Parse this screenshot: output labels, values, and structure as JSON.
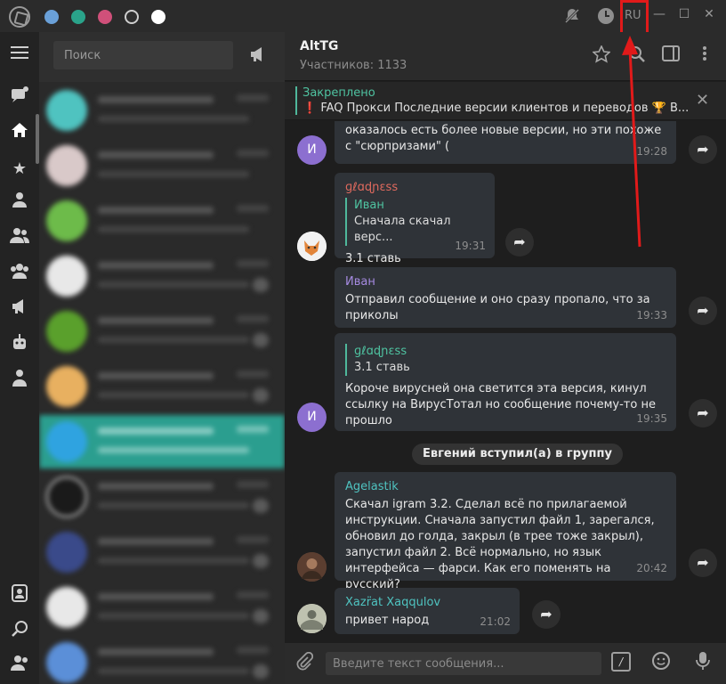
{
  "theme_colors": [
    "#6aa0d8",
    "#2aa38a",
    "#d0507a",
    "#2f2f2f",
    "#ffffff"
  ],
  "titlebar": {
    "lang": "RU"
  },
  "search": {
    "placeholder": "Поиск"
  },
  "chat": {
    "title": "AltTG",
    "subtitle": "Участников: 1133"
  },
  "pinned": {
    "title": "Закреплено",
    "text": "❗ FAQ  Прокси   Последние версии клиентов и переводов 🏆 В..."
  },
  "messages": [
    {
      "text": "оказалось есть более новые версии, но эти похоже с \"сюрпризами\" (",
      "time": "19:28",
      "avatar": "И"
    },
    {
      "sender": "ɡℓɑɖɲɛss",
      "reply_name": "Иван",
      "reply_text": "Сначала скачал верс...",
      "text": "3.1 ставь",
      "time": "19:31"
    },
    {
      "sender": "Иван",
      "text": "Отправил сообщение и оно сразу пропало, что за приколы",
      "time": "19:33"
    },
    {
      "reply_name": "ɡℓɑɖɲɛss",
      "reply_text": "3.1 ставь",
      "text": "Короче вирусней она светится эта версия, кинул ссылку на ВирусТотал но сообщение почему-то не прошло",
      "time": "19:35",
      "avatar": "И"
    },
    {
      "sender": "Agelastik",
      "text": "Скачал igram 3.2. Сделал всё по прилагаемой инструкции. Сначала запустил файл 1, зарегался, обновил до голда, закрыл (в трее тоже закрыл), запустил файл 2. Всё нормально, но язык интерфейса — фарси. Как его поменять на русский?",
      "time": "20:42"
    },
    {
      "sender": "Xazr̈at Xaqqulov",
      "text": "привет народ",
      "time": "21:02"
    }
  ],
  "service_message": "Евгений вступил(а) в группу",
  "compose": {
    "placeholder": "Введите текст сообщения..."
  },
  "chatlist_avatar_colors": [
    "#4fc3c0",
    "#d9c9c9",
    "#6dbb4a",
    "#e8e8e8",
    "#5aa02c",
    "#e8b060",
    "#2fa3e0",
    "#1a1a1a",
    "#3a4a8a",
    "#e8e8e8",
    "#5b8fd8"
  ]
}
